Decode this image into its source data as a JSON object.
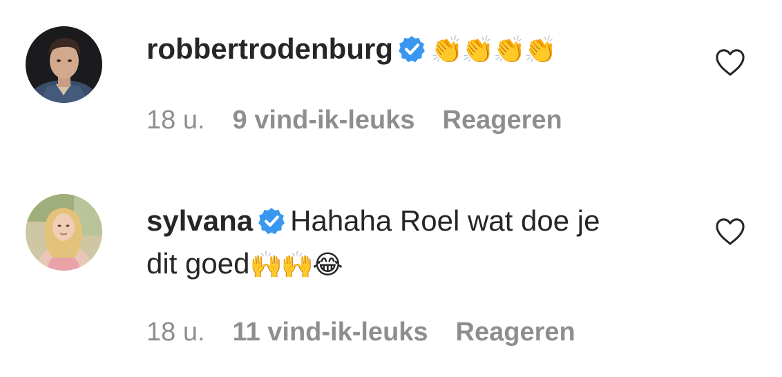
{
  "comments": [
    {
      "username": "robbertrodenburg",
      "verified": true,
      "text_line1": "",
      "text_line2": "",
      "emoji_line1": "👏👏👏👏",
      "emoji_line2": "",
      "time": "18 u.",
      "likes": "9 vind-ik-leuks",
      "reply_label": "Reageren"
    },
    {
      "username": "sylvana",
      "verified": true,
      "text_line1": "Hahaha Roel wat doe je",
      "text_line2": "dit goed",
      "emoji_line1": "",
      "emoji_line2": "🙌🙌😂",
      "time": "18 u.",
      "likes": "11 vind-ik-leuks",
      "reply_label": "Reageren"
    }
  ],
  "icons": {
    "verified": "verified-badge-icon",
    "like": "heart-outline-icon"
  },
  "colors": {
    "text": "#262626",
    "meta": "#8e8e8e",
    "verified_badge": "#3897f0"
  }
}
